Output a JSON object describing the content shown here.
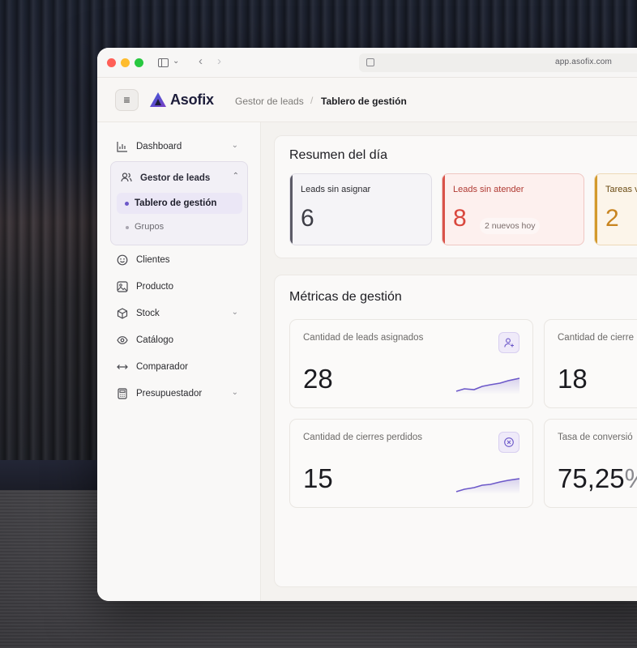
{
  "browser": {
    "url": "app.asofix.com"
  },
  "header": {
    "brand": "Asofix",
    "breadcrumb": [
      "Gestor de leads",
      "Tablero de gestión"
    ],
    "breadcrumb_sep": "/"
  },
  "sidebar": {
    "items": [
      {
        "label": "Dashboard",
        "icon": "bar-chart-icon",
        "has_children": true
      },
      {
        "label": "Gestor de leads",
        "icon": "users-icon",
        "expanded": true,
        "children": [
          {
            "label": "Tablero de gestión",
            "active": true
          },
          {
            "label": "Grupos",
            "active": false
          }
        ]
      },
      {
        "label": "Clientes",
        "icon": "smile-icon"
      },
      {
        "label": "Producto",
        "icon": "image-icon"
      },
      {
        "label": "Stock",
        "icon": "box-icon",
        "has_children": true
      },
      {
        "label": "Catálogo",
        "icon": "eye-icon"
      },
      {
        "label": "Comparador",
        "icon": "arrows-horizontal-icon"
      },
      {
        "label": "Presupuestador",
        "icon": "calculator-icon",
        "has_children": true
      }
    ]
  },
  "resumen": {
    "title": "Resumen del día",
    "cards": [
      {
        "label": "Leads sin asignar",
        "value": "6",
        "color": "#5b5a66"
      },
      {
        "label": "Leads sin atender",
        "value": "8",
        "badge": "2 nuevos hoy",
        "color": "#d9534a"
      },
      {
        "label": "Tareas v",
        "value": "2",
        "color": "#d39a2d"
      }
    ]
  },
  "metricas": {
    "title": "Métricas de gestión",
    "cards": [
      {
        "label": "Cantidad de leads asignados",
        "value": "28",
        "icon": "user-plus-icon"
      },
      {
        "label": "Cantidad de cierre",
        "value": "18"
      },
      {
        "label": "Cantidad de cierres perdidos",
        "value": "15",
        "icon": "x-circle-icon"
      },
      {
        "label": "Tasa de conversió",
        "value": "75,25",
        "value_suffix": "%"
      }
    ],
    "accent": "#6c58c9"
  }
}
